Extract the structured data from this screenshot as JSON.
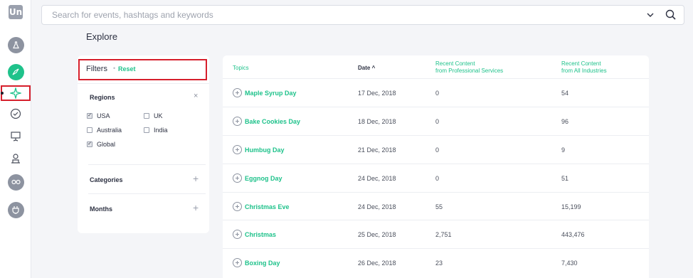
{
  "sidebar": {
    "logo_text": "Un",
    "items": [
      {
        "name": "lab-flask-icon"
      },
      {
        "name": "compass-icon"
      },
      {
        "name": "explore-sparkle-icon"
      },
      {
        "name": "checkmark-circle-icon"
      },
      {
        "name": "presentation-icon"
      },
      {
        "name": "person-podium-icon"
      },
      {
        "name": "glasses-icon"
      },
      {
        "name": "plug-icon"
      }
    ],
    "active_index": 2
  },
  "search": {
    "placeholder": "Search for events, hashtags and keywords",
    "value": ""
  },
  "page": {
    "title": "Explore"
  },
  "filters": {
    "title": "Filters",
    "separator": "•",
    "reset_label": "Reset",
    "regions": {
      "title": "Regions",
      "close_symbol": "×",
      "options": [
        {
          "label": "USA",
          "checked": true
        },
        {
          "label": "UK",
          "checked": false
        },
        {
          "label": "Australia",
          "checked": false
        },
        {
          "label": "India",
          "checked": false
        },
        {
          "label": "Global",
          "checked": true
        }
      ]
    },
    "categories": {
      "title": "Categories",
      "expand_symbol": "+"
    },
    "months": {
      "title": "Months",
      "expand_symbol": "+"
    }
  },
  "table": {
    "headers": {
      "topics": "Topics",
      "date": "Date",
      "date_sort": "^",
      "prof_line1": "Recent Content",
      "prof_line2": "from Professional Services",
      "all_line1": "Recent Content",
      "all_line2": "from All Industries"
    },
    "rows": [
      {
        "topic": "Maple Syrup Day",
        "date": "17 Dec, 2018",
        "prof": "0",
        "all": "54"
      },
      {
        "topic": "Bake Cookies Day",
        "date": "18 Dec, 2018",
        "prof": "0",
        "all": "96"
      },
      {
        "topic": "Humbug Day",
        "date": "21 Dec, 2018",
        "prof": "0",
        "all": "9"
      },
      {
        "topic": "Eggnog Day",
        "date": "24 Dec, 2018",
        "prof": "0",
        "all": "51"
      },
      {
        "topic": "Christmas Eve",
        "date": "24 Dec, 2018",
        "prof": "55",
        "all": "15,199"
      },
      {
        "topic": "Christmas",
        "date": "25 Dec, 2018",
        "prof": "2,751",
        "all": "443,476"
      },
      {
        "topic": "Boxing Day",
        "date": "26 Dec, 2018",
        "prof": "23",
        "all": "7,430"
      }
    ]
  },
  "colors": {
    "accent": "#1fc28b",
    "highlight": "#d61f2c",
    "icon_grey": "#8d93a0"
  }
}
